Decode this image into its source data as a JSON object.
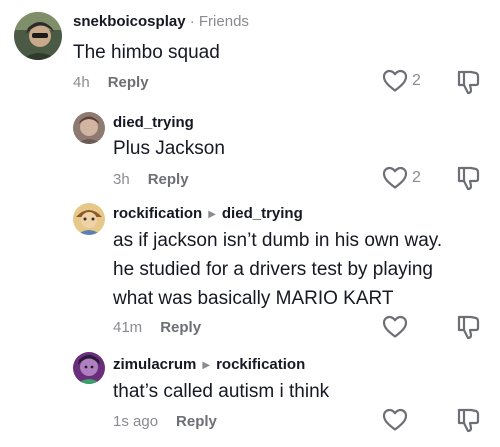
{
  "comments": [
    {
      "username": "snekboicosplay",
      "badge": "Friends",
      "text": "The himbo squad",
      "time": "4h",
      "reply_label": "Reply",
      "likes": "2",
      "avatar_color": "#5b6a52"
    },
    {
      "username": "died_trying",
      "text": "Plus Jackson",
      "time": "3h",
      "reply_label": "Reply",
      "likes": "2",
      "avatar_color": "#b89a8a"
    },
    {
      "username": "rockification",
      "reply_to": "died_trying",
      "text_lines": [
        "as if jackson isn’t dumb in his own way.",
        "he studied for a drivers test by playing",
        "what was basically MARIO KART"
      ],
      "time": "41m",
      "reply_label": "Reply",
      "avatar_color": "#d9a64a"
    },
    {
      "username": "zimulacrum",
      "reply_to": "rockification",
      "text": "that’s called autism i think",
      "time": "1s ago",
      "reply_label": "Reply",
      "avatar_color": "#7a3f8f"
    }
  ],
  "colors": {
    "text": "#161823",
    "muted": "#8a8b91",
    "reply": "#6e6f75"
  }
}
